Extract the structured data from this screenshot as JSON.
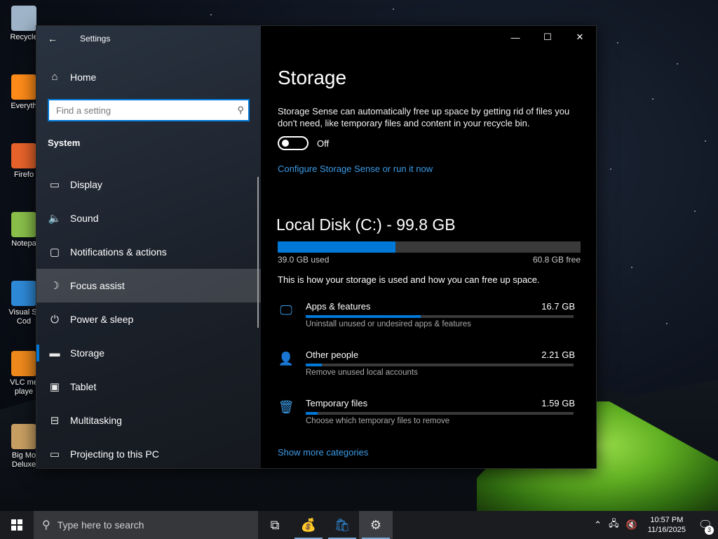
{
  "desktop": {
    "icons": [
      {
        "label": "Recycle",
        "icon": "recycle-bin-icon",
        "color": "#9fb4c8"
      },
      {
        "label": "Everyth",
        "icon": "magnifier-icon",
        "color": "#ff8c1a"
      },
      {
        "label": "Firefo",
        "icon": "firefox-icon",
        "color": "#e8632b"
      },
      {
        "label": "Notepa",
        "icon": "notepad-icon",
        "color": "#8ac04a"
      },
      {
        "label": "Visual St Cod",
        "icon": "vscode-icon",
        "color": "#2f8ad8"
      },
      {
        "label": "VLC me playe",
        "icon": "vlc-cone-icon",
        "color": "#f08a1c"
      },
      {
        "label": "Big Mo Deluxe",
        "icon": "money-bag-icon",
        "color": "#c9a063"
      }
    ]
  },
  "window": {
    "title": "Settings",
    "controls": {
      "minimize": "—",
      "maximize": "☐",
      "close": "✕"
    }
  },
  "nav": {
    "home_label": "Home",
    "search_placeholder": "Find a setting",
    "section": "System",
    "items": [
      {
        "label": "Display",
        "icon": "monitor-icon",
        "glyph": "▭"
      },
      {
        "label": "Sound",
        "icon": "speaker-icon",
        "glyph": "🔈"
      },
      {
        "label": "Notifications & actions",
        "icon": "message-icon",
        "glyph": "▢"
      },
      {
        "label": "Focus assist",
        "icon": "moon-icon",
        "glyph": "☽"
      },
      {
        "label": "Power & sleep",
        "icon": "power-icon",
        "glyph": "⏻"
      },
      {
        "label": "Storage",
        "icon": "drive-icon",
        "glyph": "▬"
      },
      {
        "label": "Tablet",
        "icon": "tablet-icon",
        "glyph": "▣"
      },
      {
        "label": "Multitasking",
        "icon": "multitasking-icon",
        "glyph": "⊟"
      },
      {
        "label": "Projecting to this PC",
        "icon": "projector-icon",
        "glyph": "▭"
      }
    ]
  },
  "main": {
    "title": "Storage",
    "description": "Storage Sense can automatically free up space by getting rid of files you don't need, like temporary files and content in your recycle bin.",
    "toggle_state": "Off",
    "configure_link": "Configure Storage Sense or run it now",
    "disk_title": "Local Disk (C:) - 99.8 GB",
    "disk_used": "39.0 GB used",
    "disk_free": "60.8 GB free",
    "disk_used_fraction": 0.39,
    "how_text": "This is how your storage is used and how you can free up space.",
    "categories": [
      {
        "name": "Apps & features",
        "size": "16.7 GB",
        "sub": "Uninstall unused or undesired apps & features",
        "fraction": 0.43,
        "icon": "apps-monitor-icon",
        "glyph": "🖵"
      },
      {
        "name": "Other people",
        "size": "2.21 GB",
        "sub": "Remove unused local accounts",
        "fraction": 0.06,
        "icon": "person-icon",
        "glyph": "👤"
      },
      {
        "name": "Temporary files",
        "size": "1.59 GB",
        "sub": "Choose which temporary files to remove",
        "fraction": 0.045,
        "icon": "trash-icon",
        "glyph": "🗑"
      }
    ],
    "more_link": "Show more categories"
  },
  "taskbar": {
    "search_placeholder": "Type here to search",
    "time": "10:57 PM",
    "date": "11/16/2025",
    "notification_count": "3"
  },
  "colors": {
    "accent": "#0078d7",
    "link": "#3c9be6"
  }
}
